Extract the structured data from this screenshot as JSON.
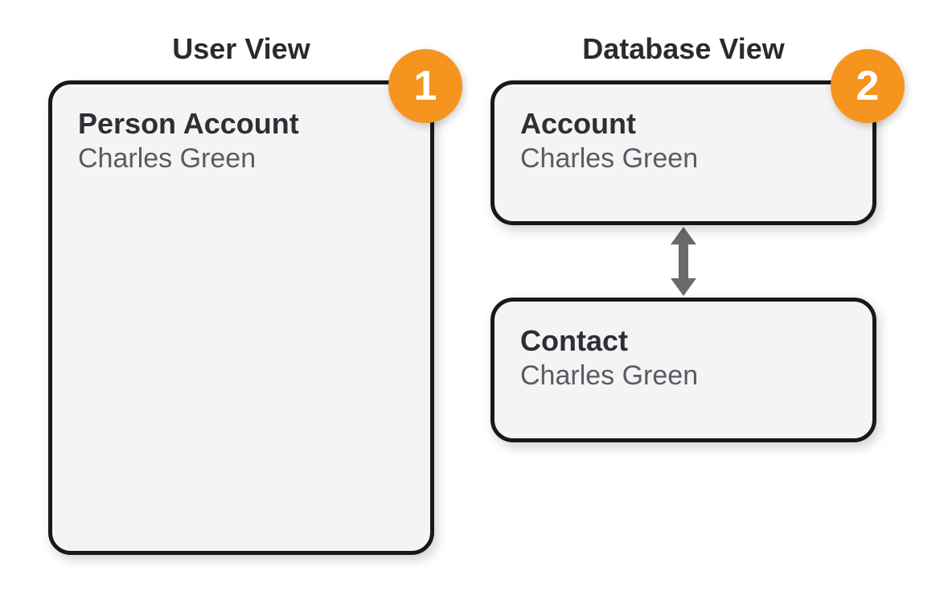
{
  "left": {
    "title": "User View",
    "badge": "1",
    "card": {
      "label": "Person Account",
      "value": "Charles Green"
    }
  },
  "right": {
    "title": "Database View",
    "badge": "2",
    "card_top": {
      "label": "Account",
      "value": "Charles Green"
    },
    "card_bottom": {
      "label": "Contact",
      "value": "Charles Green"
    }
  }
}
